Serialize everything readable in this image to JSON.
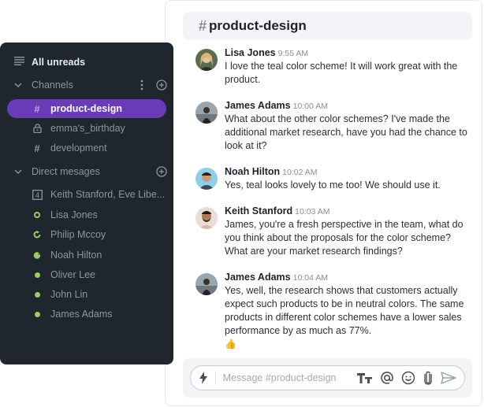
{
  "sidebar": {
    "all_unreads": "All unreads",
    "channels_label": "Channels",
    "dm_label": "Direct mesages",
    "channels": [
      {
        "name": "product-design",
        "icon": "hash-icon",
        "active": true
      },
      {
        "name": "emma's_birthday",
        "icon": "lock-icon",
        "active": false
      },
      {
        "name": "development",
        "icon": "hash-icon",
        "active": false
      }
    ],
    "direct_messages": [
      {
        "name": "Keith Stanford, Eve Libe...",
        "icon": "group-count-icon",
        "count": "4"
      },
      {
        "name": "Lisa Jones",
        "icon": "status-away-icon"
      },
      {
        "name": "Philip Mccoy",
        "icon": "status-refresh-icon"
      },
      {
        "name": "Noah Hilton",
        "icon": "status-snooze-icon"
      },
      {
        "name": "Oliver Lee",
        "icon": "status-online-icon"
      },
      {
        "name": "John Lin",
        "icon": "status-online-icon"
      },
      {
        "name": "James Adams",
        "icon": "status-online-icon"
      }
    ]
  },
  "chat": {
    "hash": "#",
    "title": "product-design",
    "messages": [
      {
        "author": "Lisa Jones",
        "time": "9:55 AM",
        "text": "I love the teal color scheme! It will work great with the product.",
        "avatar_color": "#c9a27a"
      },
      {
        "author": "James Adams",
        "time": "10:00 AM",
        "text": "What about the other color schemes? I've made the additional market research, have you had the chance to look at it?",
        "avatar_color": "#7b8794"
      },
      {
        "author": "Noah Hilton",
        "time": "10:02 AM",
        "text": "Yes, teal looks lovely to me too! We should use it.",
        "avatar_color": "#7fc4dc"
      },
      {
        "author": "Keith Stanford",
        "time": "10:03 AM",
        "text": "James, you're a fresh perspective in the team, what do you think about the proposals for the color scheme? What are your market research findings?",
        "avatar_color": "#c8a79a"
      },
      {
        "author": "James Adams",
        "time": "10:04 AM",
        "text": "Yes, well, the research shows that customers actually expect such products to be in neutral colors. The same products in different color schemes have a lower sales performance by as much as 77%.",
        "emoji": "👍",
        "avatar_color": "#7b8794"
      }
    ]
  },
  "composer": {
    "placeholder": "Message #product-design",
    "value": ""
  },
  "colors": {
    "accent": "#6a3bb8",
    "sidebar_bg": "#1f262d",
    "status_green": "#9ccc65"
  }
}
